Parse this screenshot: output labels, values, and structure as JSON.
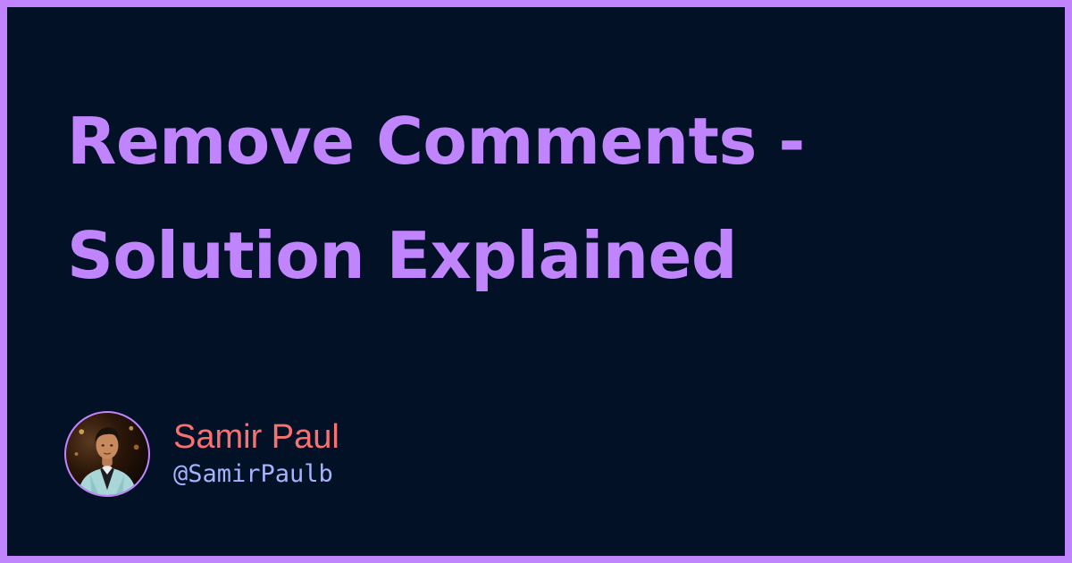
{
  "title": "Remove Comments - Solution Explained",
  "author": {
    "name": "Samir Paul",
    "handle": "@SamirPaulb"
  },
  "colors": {
    "border": "#c084fc",
    "background": "#031127",
    "title": "#c084fc",
    "name": "#f87171",
    "handle": "#a5b4fc"
  }
}
